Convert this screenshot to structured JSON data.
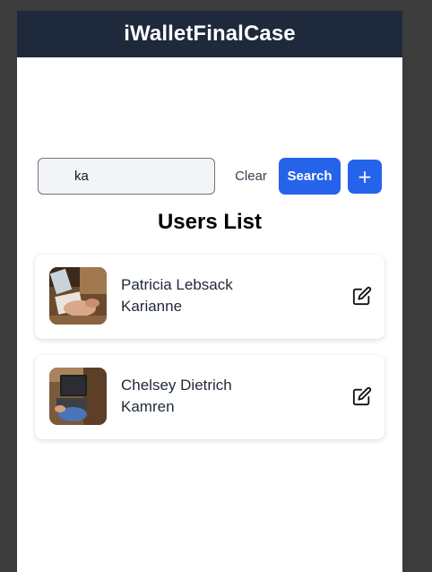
{
  "app": {
    "title": "iWalletFinalCase"
  },
  "search": {
    "value": "ka",
    "clear_label": "Clear",
    "search_label": "Search",
    "add_label": "+"
  },
  "list": {
    "title": "Users List",
    "users": [
      {
        "name": "Patricia Lebsack",
        "username": "Karianne"
      },
      {
        "name": "Chelsey Dietrich",
        "username": "Kamren"
      }
    ]
  },
  "colors": {
    "header_bg": "#1e293b",
    "primary": "#2563eb",
    "frame_bg": "#3c3c3c"
  },
  "icons": {
    "edit": "edit-icon",
    "avatar": "avatar-photo"
  }
}
